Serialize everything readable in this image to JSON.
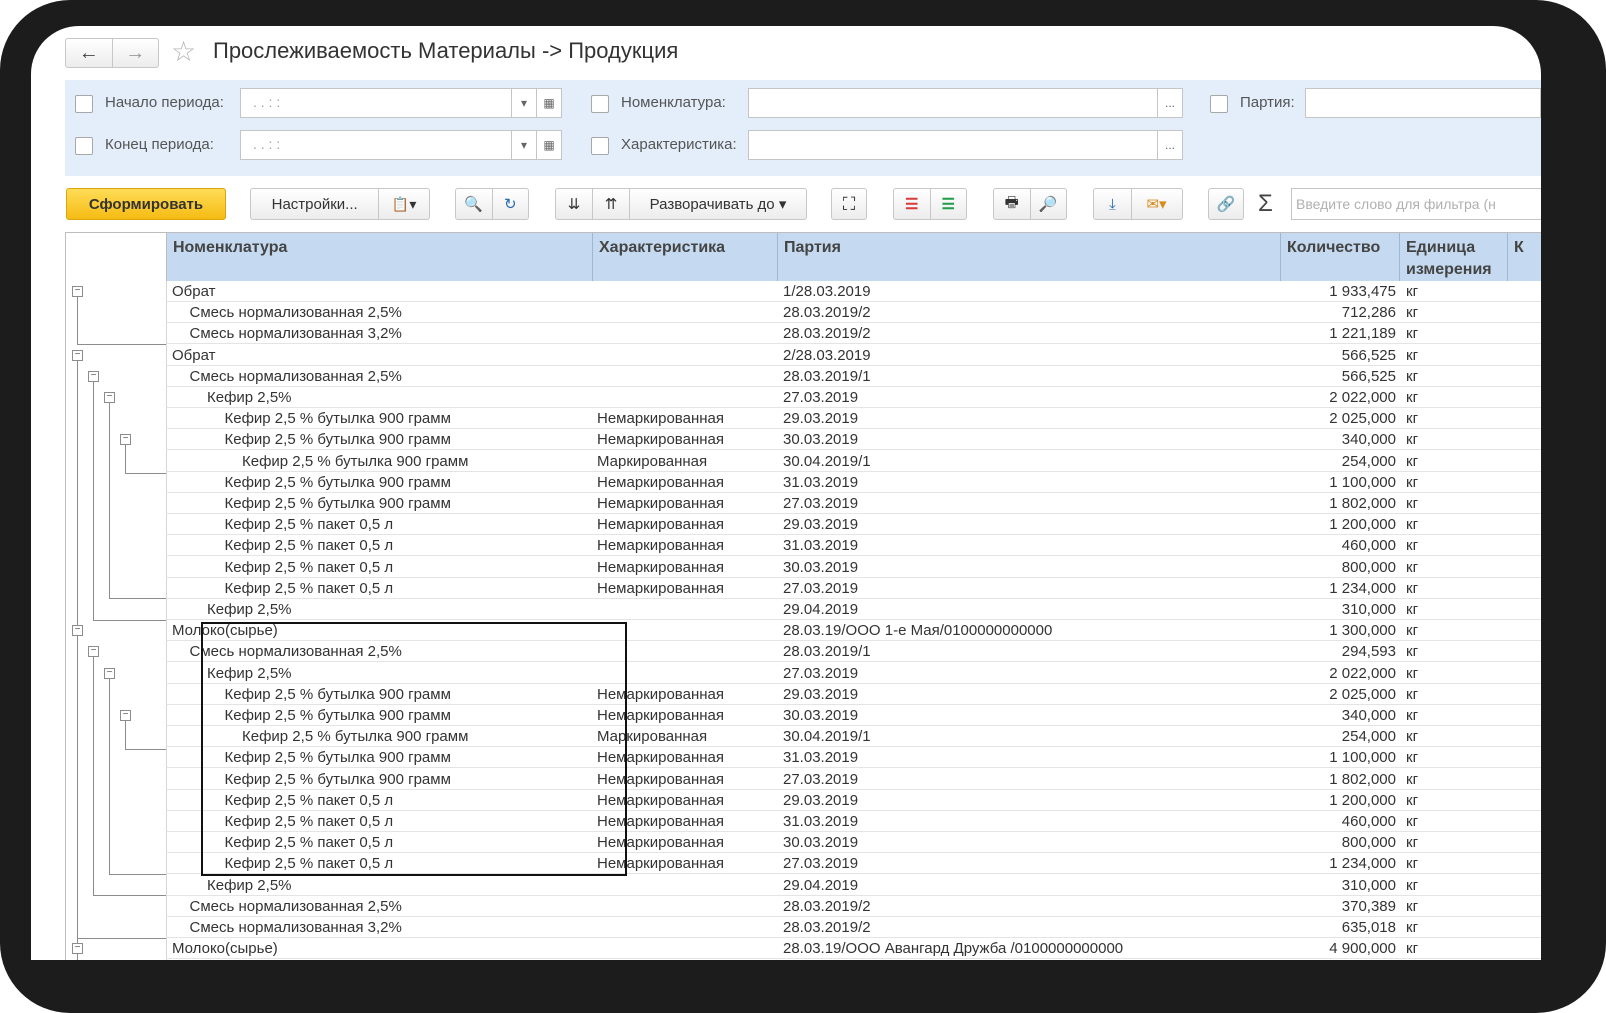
{
  "header": {
    "title": "Прослеживаемость Материалы -> Продукция",
    "back": "←",
    "forward": "→",
    "star": "☆"
  },
  "filters": {
    "period_start_label": "Начало периода:",
    "period_end_label": "Конец периода:",
    "period_start_value": ". .      : :",
    "period_end_value": ". .      : :",
    "nomenclature_label": "Номенклатура:",
    "characteristic_label": "Характеристика:",
    "batch_label": "Партия:",
    "more": "..."
  },
  "toolbar": {
    "generate": "Сформировать",
    "settings": "Настройки...",
    "expand_to": "Разворачивать до",
    "search_placeholder": "Введите слово для фильтра (н",
    "sigma": "Σ"
  },
  "columns": {
    "nomenclature": "Номенклатура",
    "characteristic": "Характеристика",
    "batch": "Партия",
    "quantity": "Количество",
    "unit": "Единица измерения",
    "extra": "К"
  },
  "rows": [
    {
      "level": 0,
      "name": "Обрат",
      "char": "",
      "batch": "1/28.03.2019",
      "qty": "1 933,475",
      "unit": "кг"
    },
    {
      "level": 1,
      "name": "Смесь нормализованная 2,5%",
      "char": "",
      "batch": "28.03.2019/2",
      "qty": "712,286",
      "unit": "кг"
    },
    {
      "level": 1,
      "name": "Смесь нормализованная 3,2%",
      "char": "",
      "batch": "28.03.2019/2",
      "qty": "1 221,189",
      "unit": "кг"
    },
    {
      "level": 0,
      "name": "Обрат",
      "char": "",
      "batch": "2/28.03.2019",
      "qty": "566,525",
      "unit": "кг"
    },
    {
      "level": 1,
      "name": "Смесь нормализованная 2,5%",
      "char": "",
      "batch": "28.03.2019/1",
      "qty": "566,525",
      "unit": "кг"
    },
    {
      "level": 2,
      "name": "Кефир 2,5%",
      "char": "",
      "batch": "27.03.2019",
      "qty": "2 022,000",
      "unit": "кг"
    },
    {
      "level": 3,
      "name": "Кефир 2,5 % бутылка 900 грамм",
      "char": "Немаркированная",
      "batch": "29.03.2019",
      "qty": "2 025,000",
      "unit": "кг"
    },
    {
      "level": 3,
      "name": "Кефир 2,5 % бутылка 900 грамм",
      "char": "Немаркированная",
      "batch": "30.03.2019",
      "qty": "340,000",
      "unit": "кг"
    },
    {
      "level": 4,
      "name": "Кефир 2,5 % бутылка 900 грамм",
      "char": "Маркированная",
      "batch": "30.04.2019/1",
      "qty": "254,000",
      "unit": "кг"
    },
    {
      "level": 3,
      "name": "Кефир 2,5 % бутылка 900 грамм",
      "char": "Немаркированная",
      "batch": "31.03.2019",
      "qty": "1 100,000",
      "unit": "кг"
    },
    {
      "level": 3,
      "name": "Кефир 2,5 % бутылка 900 грамм",
      "char": "Немаркированная",
      "batch": "27.03.2019",
      "qty": "1 802,000",
      "unit": "кг"
    },
    {
      "level": 3,
      "name": "Кефир 2,5 % пакет 0,5 л",
      "char": "Немаркированная",
      "batch": "29.03.2019",
      "qty": "1 200,000",
      "unit": "кг"
    },
    {
      "level": 3,
      "name": "Кефир 2,5 % пакет 0,5 л",
      "char": "Немаркированная",
      "batch": "31.03.2019",
      "qty": "460,000",
      "unit": "кг"
    },
    {
      "level": 3,
      "name": "Кефир 2,5 % пакет 0,5 л",
      "char": "Немаркированная",
      "batch": "30.03.2019",
      "qty": "800,000",
      "unit": "кг"
    },
    {
      "level": 3,
      "name": "Кефир 2,5 % пакет 0,5 л",
      "char": "Немаркированная",
      "batch": "27.03.2019",
      "qty": "1 234,000",
      "unit": "кг"
    },
    {
      "level": 2,
      "name": "Кефир 2,5%",
      "char": "",
      "batch": "29.04.2019",
      "qty": "310,000",
      "unit": "кг"
    },
    {
      "level": 0,
      "name": "Молоко(сырье)",
      "char": "",
      "batch": "28.03.19/ООО 1-е Мая/0100000000000",
      "qty": "1 300,000",
      "unit": "кг"
    },
    {
      "level": 1,
      "name": "Смесь нормализованная 2,5%",
      "char": "",
      "batch": "28.03.2019/1",
      "qty": "294,593",
      "unit": "кг"
    },
    {
      "level": 2,
      "name": "Кефир 2,5%",
      "char": "",
      "batch": "27.03.2019",
      "qty": "2 022,000",
      "unit": "кг"
    },
    {
      "level": 3,
      "name": "Кефир 2,5 % бутылка 900 грамм",
      "char": "Немаркированная",
      "batch": "29.03.2019",
      "qty": "2 025,000",
      "unit": "кг"
    },
    {
      "level": 3,
      "name": "Кефир 2,5 % бутылка 900 грамм",
      "char": "Немаркированная",
      "batch": "30.03.2019",
      "qty": "340,000",
      "unit": "кг"
    },
    {
      "level": 4,
      "name": "Кефир 2,5 % бутылка 900 грамм",
      "char": "Маркированная",
      "batch": "30.04.2019/1",
      "qty": "254,000",
      "unit": "кг"
    },
    {
      "level": 3,
      "name": "Кефир 2,5 % бутылка 900 грамм",
      "char": "Немаркированная",
      "batch": "31.03.2019",
      "qty": "1 100,000",
      "unit": "кг"
    },
    {
      "level": 3,
      "name": "Кефир 2,5 % бутылка 900 грамм",
      "char": "Немаркированная",
      "batch": "27.03.2019",
      "qty": "1 802,000",
      "unit": "кг"
    },
    {
      "level": 3,
      "name": "Кефир 2,5 % пакет 0,5 л",
      "char": "Немаркированная",
      "batch": "29.03.2019",
      "qty": "1 200,000",
      "unit": "кг"
    },
    {
      "level": 3,
      "name": "Кефир 2,5 % пакет 0,5 л",
      "char": "Немаркированная",
      "batch": "31.03.2019",
      "qty": "460,000",
      "unit": "кг"
    },
    {
      "level": 3,
      "name": "Кефир 2,5 % пакет 0,5 л",
      "char": "Немаркированная",
      "batch": "30.03.2019",
      "qty": "800,000",
      "unit": "кг"
    },
    {
      "level": 3,
      "name": "Кефир 2,5 % пакет 0,5 л",
      "char": "Немаркированная",
      "batch": "27.03.2019",
      "qty": "1 234,000",
      "unit": "кг"
    },
    {
      "level": 2,
      "name": "Кефир 2,5%",
      "char": "",
      "batch": "29.04.2019",
      "qty": "310,000",
      "unit": "кг"
    },
    {
      "level": 1,
      "name": "Смесь нормализованная 2,5%",
      "char": "",
      "batch": "28.03.2019/2",
      "qty": "370,389",
      "unit": "кг"
    },
    {
      "level": 1,
      "name": "Смесь нормализованная 3,2%",
      "char": "",
      "batch": "28.03.2019/2",
      "qty": "635,018",
      "unit": "кг"
    },
    {
      "level": 0,
      "name": "Молоко(сырье)",
      "char": "",
      "batch": "28.03.19/ООО Авангард Дружба  /0100000000000",
      "qty": "4 900,000",
      "unit": "кг"
    }
  ],
  "colors": {
    "accent": "#f5bb13",
    "header_bg": "#c5daf0",
    "filter_bg": "#e3eefa"
  }
}
